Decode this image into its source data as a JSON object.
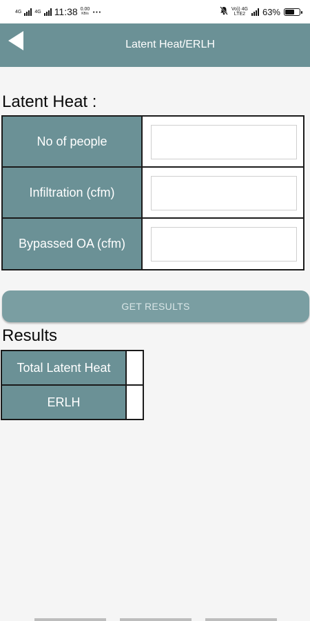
{
  "status_bar": {
    "network_left_1": "4G",
    "network_left_2": "4G",
    "time": "11:38",
    "data_speed_value": "0.00",
    "data_speed_unit": "KB/s",
    "more": "···",
    "network_right_top": "Vo)) 4G",
    "network_right_bottom": "LTE2",
    "battery_percent": "63%",
    "battery_level": 0.63,
    "icons": [
      "signal-icon",
      "signal-icon",
      "more-dots-icon",
      "mute-icon",
      "signal-icon",
      "battery-icon"
    ]
  },
  "app_bar": {
    "title": "Latent Heat/ERLH",
    "back_icon": "back-arrow-icon",
    "color": "#6b9196"
  },
  "latent_heat": {
    "heading": "Latent Heat :",
    "rows": [
      {
        "label": "No of people",
        "value": ""
      },
      {
        "label": "Infiltration (cfm)",
        "value": ""
      },
      {
        "label": "Bypassed OA (cfm)",
        "value": ""
      }
    ]
  },
  "button": {
    "label": "GET RESULTS",
    "color": "#7a9ea2"
  },
  "results": {
    "heading": "Results",
    "rows": [
      {
        "label": "Total Latent Heat",
        "value": ""
      },
      {
        "label": "ERLH",
        "value": ""
      }
    ]
  }
}
